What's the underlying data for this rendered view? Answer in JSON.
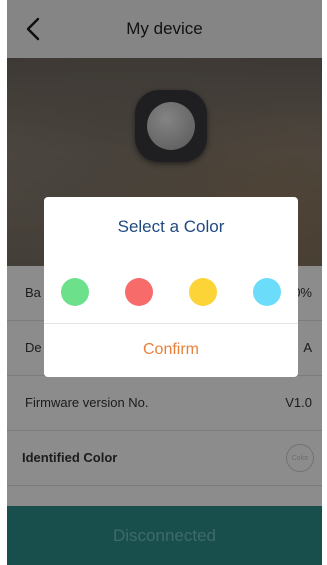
{
  "header": {
    "title": "My device"
  },
  "rows": [
    {
      "label": "Ba",
      "value": "0%"
    },
    {
      "label": "De",
      "value": "A"
    },
    {
      "label": "Firmware version No.",
      "value": "V1.0"
    },
    {
      "label": "Identified Color",
      "badge": "Color"
    }
  ],
  "status": {
    "label": "Disconnected"
  },
  "dialog": {
    "title": "Select a Color",
    "colors": [
      "#6de08b",
      "#f86b6b",
      "#fcd438",
      "#6cdcfb"
    ],
    "confirm_label": "Confirm"
  },
  "icons": {
    "back": "chevron-left-icon",
    "device": "device-image"
  },
  "theme": {
    "status_bar": "#2d8e8a",
    "status_text": "#6fc3bd",
    "accent": "#e8803c",
    "dialog_title": "#1f4a80"
  }
}
